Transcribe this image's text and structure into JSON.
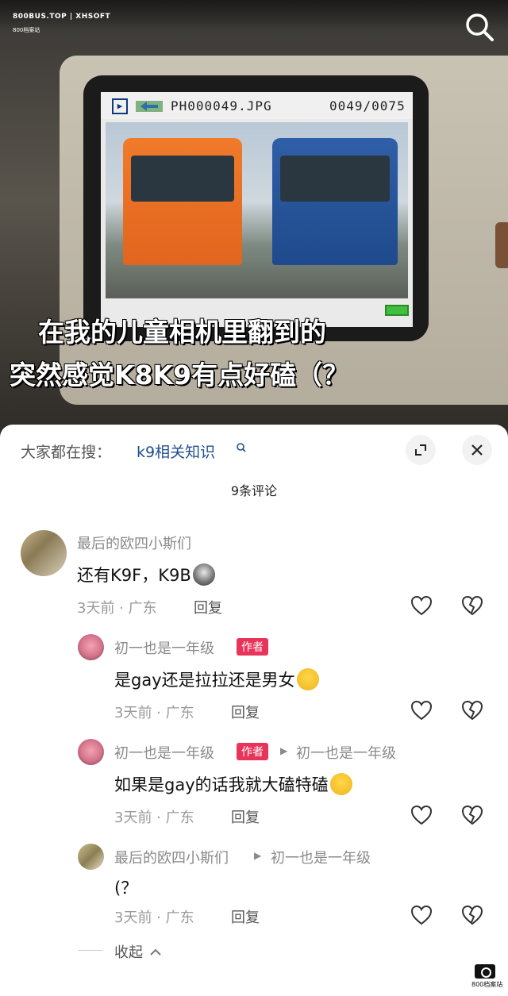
{
  "overlay": {
    "brand": "800BUS.TOP | XHSOFT",
    "brand_sub": "800档案站",
    "search_icon": "search-icon"
  },
  "camera_screen": {
    "file_name": "PH000049.JPG",
    "counter": "0049/0075"
  },
  "subtitles": [
    "在我的儿童相机里翻到的",
    "突然感觉K8K9有点好磕（？"
  ],
  "sheet": {
    "search_prefix": "大家都在搜：",
    "search_link": "k9相关知识",
    "search_link_icon": "search-small-icon",
    "expand_icon": "expand-icon",
    "close_icon": "close-icon",
    "comment_count": "9条评论",
    "author_tag": "作者",
    "collapse_label": "收起",
    "collapse_icon": "chevron-up-icon"
  },
  "comments": [
    {
      "user": "最后的欧四小斯们",
      "text": "还有K9F，K9B",
      "time": "3天前",
      "location": "广东",
      "reply_label": "回复"
    },
    {
      "user": "初一也是一年级",
      "is_author": true,
      "text": "是gay还是拉拉还是男女",
      "time": "3天前",
      "location": "广东",
      "reply_label": "回复"
    },
    {
      "user": "初一也是一年级",
      "is_author": true,
      "reply_to": "初一也是一年级",
      "text": "如果是gay的话我就大磕特磕",
      "time": "3天前",
      "location": "广东",
      "reply_label": "回复"
    },
    {
      "user": "最后的欧四小斯们",
      "reply_to": "初一也是一年级",
      "text": "(？",
      "time": "3天前",
      "location": "广东",
      "reply_label": "回复"
    }
  ],
  "footer": {
    "watermark_label": "800档案站"
  },
  "colors": {
    "author_tag": "#e8345a",
    "link": "#1f4f8f"
  }
}
